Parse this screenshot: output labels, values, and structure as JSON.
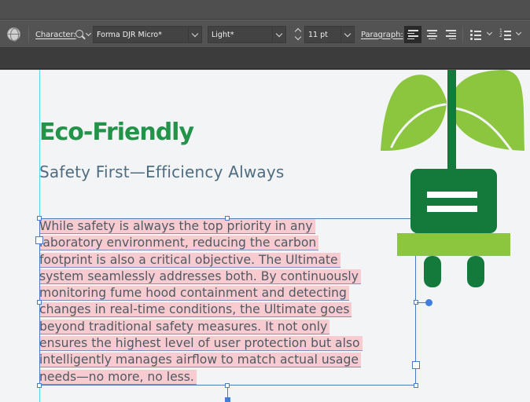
{
  "control_bar": {
    "character_label": "Character:",
    "font_family": "Forma DJR Micro*",
    "font_style": "Light*",
    "font_size": "11 pt",
    "paragraph_label": "Paragraph:"
  },
  "document": {
    "headline": "Eco-Friendly",
    "subheadline": "Safety First—Efficiency Always",
    "body_lines": [
      "While safety is always the top priority in any",
      "laboratory environment, reducing the carbon",
      "footprint is also a critical objective. The Ultimate",
      "system seamlessly addresses both. By continuously",
      "monitoring fume hood containment and detecting",
      "changes in real-time conditions, the Ultimate goes",
      "beyond traditional safety measures. It not only",
      "ensures the highest level of user protection but also",
      "intelligently manages airflow to match actual usage",
      "needs—no more, no less."
    ]
  },
  "colors": {
    "headline": "#23934a",
    "subhead": "#4f6d80",
    "text_highlight": "#f8cbd0",
    "selection": "#4a7cc5",
    "leaf_green": "#8cc63f",
    "plug_dark_green": "#137a3c"
  }
}
